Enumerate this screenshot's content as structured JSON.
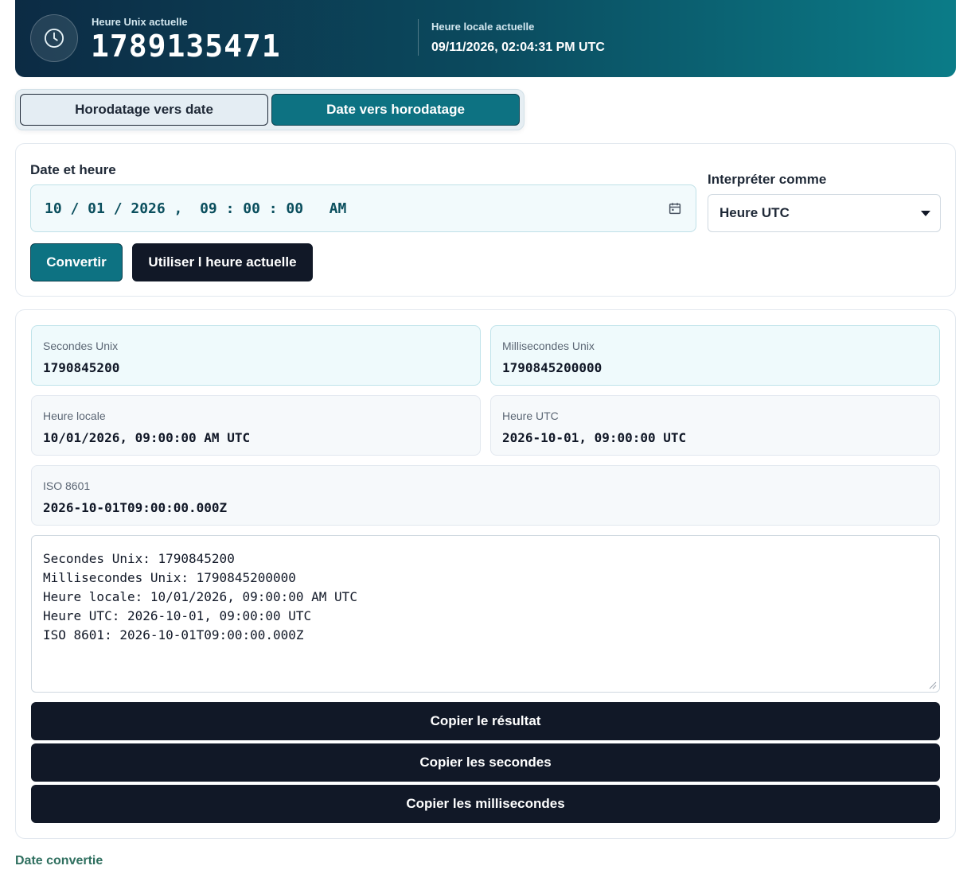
{
  "colors": {
    "banner_start": "#0c2b44",
    "banner_end": "#0b7c88",
    "accent": "#0d7282",
    "dark_button": "#111827",
    "footer_text": "#2f6f5f"
  },
  "header": {
    "icon": "clock-icon",
    "unix_label": "Heure Unix actuelle",
    "unix_value": "1789135471",
    "local_label": "Heure locale actuelle",
    "local_value": "09/11/2026, 02:04:31 PM UTC"
  },
  "tabs": [
    {
      "label": "Horodatage vers date",
      "active": false
    },
    {
      "label": "Date vers horodatage",
      "active": true
    }
  ],
  "form": {
    "datetime_label": "Date et heure",
    "datetime_value": "10 / 01 / 2026 ,  09 : 00 : 00   AM",
    "calendar_icon": "calendar-icon",
    "interpret_label": "Interpréter comme",
    "interpret_value": "Heure UTC",
    "convert_label": "Convertir",
    "now_label": "Utiliser l heure actuelle"
  },
  "results": {
    "seconds": {
      "label": "Secondes Unix",
      "value": "1790845200"
    },
    "milliseconds": {
      "label": "Millisecondes Unix",
      "value": "1790845200000"
    },
    "local": {
      "label": "Heure locale",
      "value": "10/01/2026, 09:00:00 AM UTC"
    },
    "utc": {
      "label": "Heure UTC",
      "value": "2026-10-01, 09:00:00 UTC"
    },
    "iso": {
      "label": "ISO 8601",
      "value": "2026-10-01T09:00:00.000Z"
    },
    "summary_lines": [
      "Secondes Unix: 1790845200",
      "Millisecondes Unix: 1790845200000",
      "Heure locale: 10/01/2026, 09:00:00 AM UTC",
      "Heure UTC: 2026-10-01, 09:00:00 UTC",
      "ISO 8601: 2026-10-01T09:00:00.000Z"
    ],
    "copy_result": "Copier le résultat",
    "copy_seconds": "Copier les secondes",
    "copy_milliseconds": "Copier les millisecondes"
  },
  "footer": {
    "label": "Date convertie"
  }
}
